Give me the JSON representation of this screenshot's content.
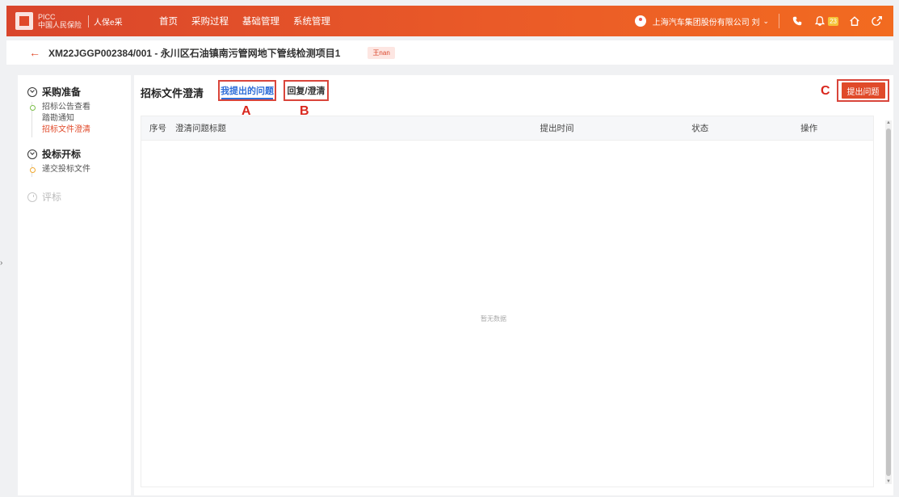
{
  "topbar": {
    "logo_text_line1": "PICC",
    "logo_text_line2": "中国人民保险",
    "logo_system": "人保e采",
    "nav": [
      "首页",
      "采购过程",
      "基础管理",
      "系统管理"
    ],
    "company": "上海汽车集团股份有限公司 刘",
    "notification_count": "23",
    "colors": {
      "bar_start": "#d9452b",
      "bar_end": "#f26b20"
    }
  },
  "project": {
    "title": "XM22JGGP002384/001 - 永川区石油镇南污管网地下管线检测项目1",
    "tag": "王nan"
  },
  "sidebar": {
    "groups": [
      {
        "label": "采购准备",
        "items": [
          "招标公告查看",
          "踏勘通知",
          "招标文件澄清"
        ]
      },
      {
        "label": "投标开标",
        "items": [
          "递交投标文件"
        ]
      },
      {
        "label": "评标",
        "items": []
      }
    ],
    "toggle": "›"
  },
  "main": {
    "title": "招标文件澄清",
    "tabs": [
      "我提出的问题",
      "回复/澄清"
    ],
    "ask_button": "提出问题",
    "markers": {
      "a": "A",
      "b": "B",
      "c": "C"
    },
    "table": {
      "columns": [
        "序号",
        "澄清问题标题",
        "提出时间",
        "状态",
        "操作"
      ],
      "empty_text": "暂无数据"
    }
  }
}
